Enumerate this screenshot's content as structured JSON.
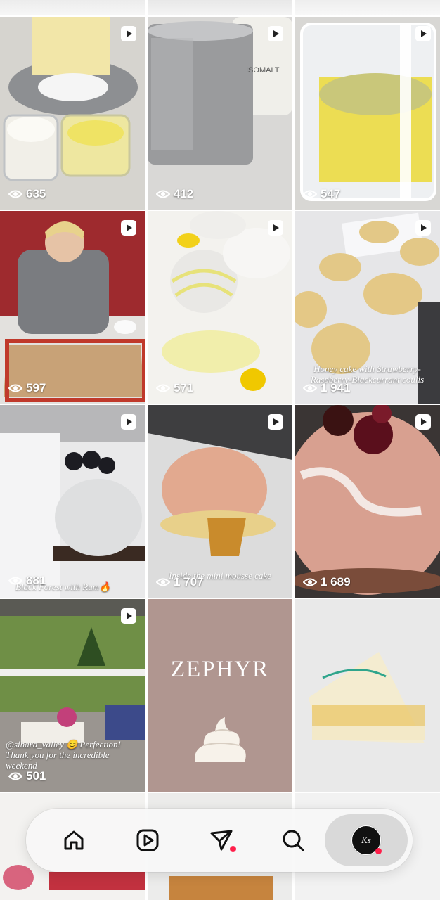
{
  "grid": {
    "cells": [
      {
        "views": "635",
        "video": true,
        "caption": ""
      },
      {
        "views": "412",
        "video": true,
        "caption": "",
        "label": "ISOMALT"
      },
      {
        "views": "547",
        "video": true,
        "caption": ""
      },
      {
        "views": "597",
        "video": true,
        "caption": ""
      },
      {
        "views": "571",
        "video": true,
        "caption": ""
      },
      {
        "views": "1 941",
        "video": true,
        "caption": "Honey cake with Strawberry-Raspberry-Blackcurrant coulis"
      },
      {
        "views": "881",
        "video": true,
        "caption": "Black Forest with Rum🔥"
      },
      {
        "views": "1 707",
        "video": true,
        "caption": "Inside the mini mousse cake"
      },
      {
        "views": "1 689",
        "video": true,
        "caption": ""
      },
      {
        "views": "501",
        "video": true,
        "caption": "@sihara_valley 😊 Perfection! Thank you for the incredible weekend"
      },
      {
        "views": "",
        "video": false,
        "caption": "",
        "title": "ZEPHYR"
      },
      {
        "views": "",
        "video": false,
        "caption": ""
      }
    ]
  },
  "nav": {
    "items": [
      {
        "name": "home",
        "icon": "home-icon"
      },
      {
        "name": "reels",
        "icon": "reels-icon"
      },
      {
        "name": "direct",
        "icon": "send-icon",
        "notification": true
      },
      {
        "name": "search",
        "icon": "search-icon"
      },
      {
        "name": "profile",
        "icon": "avatar",
        "notification": true,
        "active": true,
        "avatar_text": "Ks"
      }
    ]
  },
  "colors": {
    "notification": "#ff1f4a",
    "zephyr_bg": "#b09690"
  }
}
